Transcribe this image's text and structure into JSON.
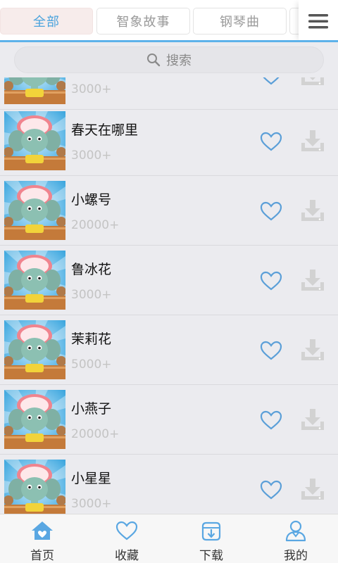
{
  "tabs": {
    "items": [
      {
        "label": "全部",
        "active": true
      },
      {
        "label": "智象故事",
        "active": false
      },
      {
        "label": "钢琴曲",
        "active": false
      }
    ],
    "menu_icon": "hamburger-menu-icon"
  },
  "search": {
    "label": "搜索",
    "icon": "search-icon"
  },
  "songs": [
    {
      "title": "",
      "count": "3000+"
    },
    {
      "title": "春天在哪里",
      "count": "3000+"
    },
    {
      "title": "小螺号",
      "count": "20000+"
    },
    {
      "title": "鲁冰花",
      "count": "3000+"
    },
    {
      "title": "茉莉花",
      "count": "5000+"
    },
    {
      "title": "小燕子",
      "count": "20000+"
    },
    {
      "title": "小星星",
      "count": "3000+"
    }
  ],
  "bottom_nav": {
    "items": [
      {
        "label": "首页",
        "icon": "home-heart-icon",
        "active": true
      },
      {
        "label": "收藏",
        "icon": "heart-icon",
        "active": false
      },
      {
        "label": "下载",
        "icon": "download-icon",
        "active": false
      },
      {
        "label": "我的",
        "icon": "user-icon",
        "active": false
      }
    ]
  },
  "colors": {
    "accent": "#4aa3dd",
    "tab_active_bg": "#f7eceb",
    "heart": "#5b9fd8",
    "download": "#d2d2d2",
    "count": "#c4c4c4"
  }
}
